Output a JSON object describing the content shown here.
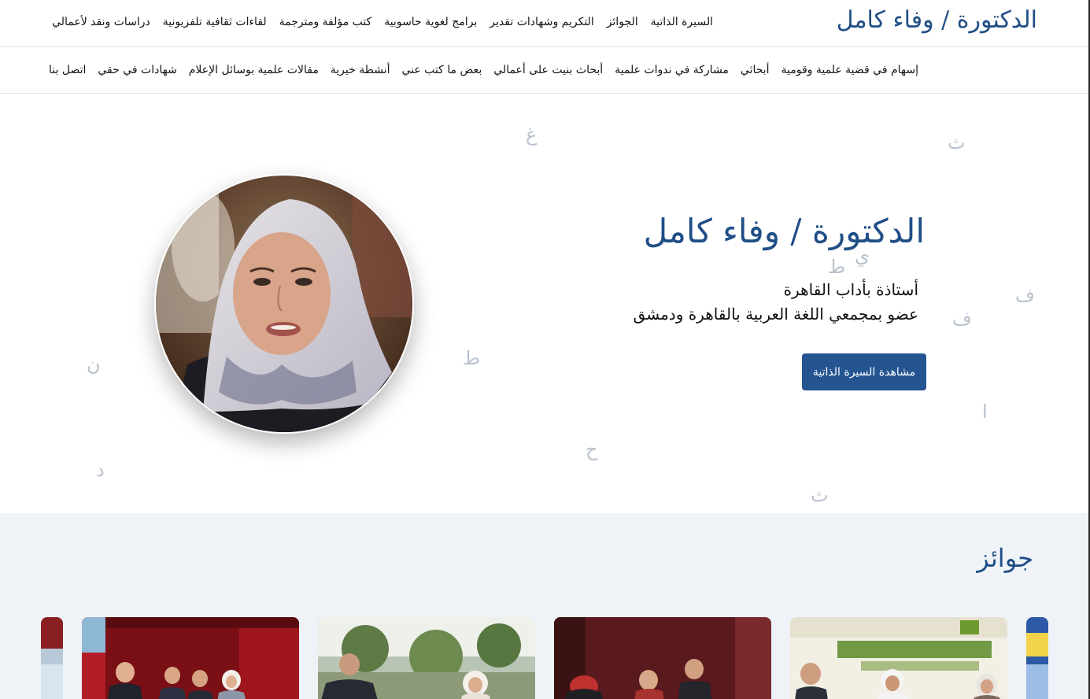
{
  "header": {
    "brand": "الدكتورة / وفاء كامل",
    "nav_primary": [
      {
        "label": "السيرة الذاتية"
      },
      {
        "label": "الجوائز"
      },
      {
        "label": "التكريم وشهادات تقدير"
      },
      {
        "label": "برامج لغوية حاسوبية"
      },
      {
        "label": "كتب مؤلفة ومترجمة"
      },
      {
        "label": "لقاءات ثقافية تلفزيونية"
      },
      {
        "label": "دراسات ونقد لأعمالي"
      }
    ],
    "nav_secondary": [
      {
        "label": "إسهام في قضية علمية وقومية"
      },
      {
        "label": "أبحاثي"
      },
      {
        "label": "مشاركة في ندوات علمية"
      },
      {
        "label": "أبحاث بنيت على أعمالي"
      },
      {
        "label": "بعض ما كتب عني"
      },
      {
        "label": "أنشطة خيرية"
      },
      {
        "label": "مقالات علمية بوسائل الإعلام"
      },
      {
        "label": "شهادات في حقي"
      },
      {
        "label": "اتصل بنا"
      }
    ]
  },
  "hero": {
    "title": "الدكتورة / وفاء كامل",
    "line1": "أستاذة بأداب القاهرة",
    "line2": "عضو بمجمعي اللغة العربية بالقاهرة ودمشق",
    "cv_button_label": "مشاهدة السيرة الذاتية",
    "decor_letters": [
      "غ",
      "ث",
      "ي",
      "ط",
      "ف",
      "ف",
      "ن",
      "ط",
      "ا",
      "ح",
      "د",
      "ث"
    ]
  },
  "awards": {
    "title": "جوائز"
  },
  "colors": {
    "brand": "#1f4e86",
    "button": "#245591",
    "awards_bg": "#eff3f8",
    "decor": "#b9c2ce"
  }
}
